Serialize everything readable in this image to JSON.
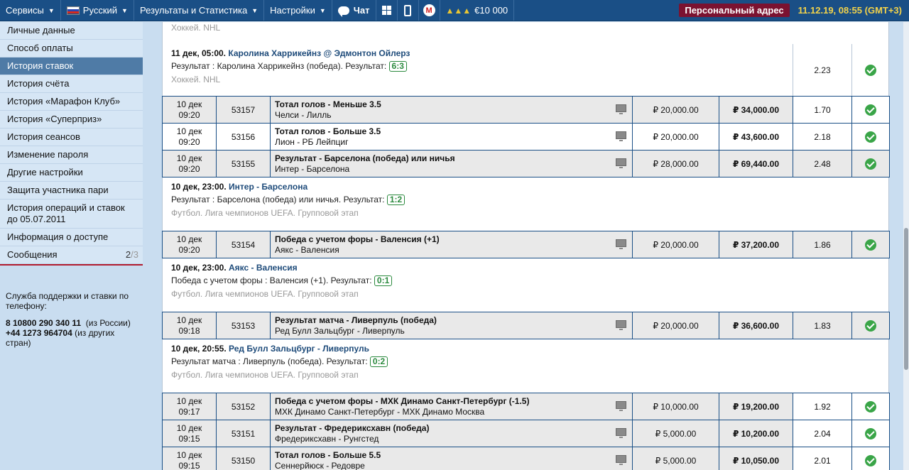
{
  "topbar": {
    "services": "Сервисы",
    "language": "Русский",
    "results": "Результаты и Статистика",
    "settings": "Настройки",
    "chat": "Чат",
    "balance": "€10 000",
    "personal": "Персональный адрес",
    "datetime": "11.12.19, 08:55 (GMT+3)"
  },
  "sidebar": {
    "items": [
      "Личные данные",
      "Способ оплаты",
      "История ставок",
      "История счёта",
      "История «Марафон Клуб»",
      "История «Суперприз»",
      "История сеансов",
      "Изменение пароля",
      "Другие настройки",
      "Защита участника пари",
      "История операций и ставок до 05.07.2011",
      "Информация о доступе",
      "Сообщения"
    ],
    "messages_read": "2",
    "messages_total": "/3",
    "support_title": "Служба поддержки и ставки по телефону:",
    "phone1": "8 10800 290 340 11",
    "phone1_note": "(из России)",
    "phone2": "+44 1273 964704",
    "phone2_note": "(из других стран)"
  },
  "top_league": "Хоккей. NHL",
  "event0": {
    "datetime": "11 дек, 05:00.",
    "teams": "Каролина Харрикейнз @ Эдмонтон Ойлерз",
    "result_text": "Результат : Каролина Харрикейнз (победа). Результат:",
    "score": "6:3",
    "league": "Хоккей. NHL",
    "odds": "2.23"
  },
  "group1": [
    {
      "date": "10 дек",
      "time": "09:20",
      "num": "53157",
      "market": "Тотал голов - Меньше 3.5",
      "match": "Челси - Лилль",
      "stake": "₽ 20,000.00",
      "win": "₽ 34,000.00",
      "odds": "1.70"
    },
    {
      "date": "10 дек",
      "time": "09:20",
      "num": "53156",
      "market": "Тотал голов - Больше 3.5",
      "match": "Лион - РБ Лейпциг",
      "stake": "₽ 20,000.00",
      "win": "₽ 43,600.00",
      "odds": "2.18"
    },
    {
      "date": "10 дек",
      "time": "09:20",
      "num": "53155",
      "market": "Результат - Барселона (победа) или ничья",
      "match": "Интер - Барселона",
      "stake": "₽ 28,000.00",
      "win": "₽ 69,440.00",
      "odds": "2.48"
    }
  ],
  "event1": {
    "datetime": "10 дек, 23:00.",
    "teams": "Интер - Барселона",
    "result_text": "Результат : Барселона (победа) или ничья. Результат:",
    "score": "1:2",
    "league": "Футбол. Лига чемпионов UEFA. Групповой этап"
  },
  "bet2": {
    "date": "10 дек",
    "time": "09:20",
    "num": "53154",
    "market": "Победа с учетом форы - Валенсия (+1)",
    "match": "Аякс - Валенсия",
    "stake": "₽ 20,000.00",
    "win": "₽ 37,200.00",
    "odds": "1.86"
  },
  "event2": {
    "datetime": "10 дек, 23:00.",
    "teams": "Аякс - Валенсия",
    "result_text": "Победа с учетом форы : Валенсия (+1). Результат:",
    "score": "0:1",
    "league": "Футбол. Лига чемпионов UEFA. Групповой этап"
  },
  "bet3": {
    "date": "10 дек",
    "time": "09:18",
    "num": "53153",
    "market": "Результат матча - Ливерпуль (победа)",
    "match": "Ред Булл Зальцбург - Ливерпуль",
    "stake": "₽ 20,000.00",
    "win": "₽ 36,600.00",
    "odds": "1.83"
  },
  "event3": {
    "datetime": "10 дек, 20:55.",
    "teams": "Ред Булл Зальцбург - Ливерпуль",
    "result_text": "Результат матча : Ливерпуль (победа). Результат:",
    "score": "0:2",
    "league": "Футбол. Лига чемпионов UEFA. Групповой этап"
  },
  "group4": [
    {
      "date": "10 дек",
      "time": "09:17",
      "num": "53152",
      "market": "Победа с учетом форы - МХК Динамо Санкт-Петербург (-1.5)",
      "match": "МХК Динамо Санкт-Петербург - МХК Динамо Москва",
      "stake": "₽ 10,000.00",
      "win": "₽ 19,200.00",
      "odds": "1.92"
    },
    {
      "date": "10 дек",
      "time": "09:15",
      "num": "53151",
      "market": "Результат - Фредериксхавн (победа)",
      "match": "Фредериксхавн - Рунгстед",
      "stake": "₽ 5,000.00",
      "win": "₽ 10,200.00",
      "odds": "2.04"
    },
    {
      "date": "10 дек",
      "time": "09:15",
      "num": "53150",
      "market": "Тотал голов - Больше 5.5",
      "match": "Сеннерйюск - Редовре",
      "stake": "₽ 5,000.00",
      "win": "₽ 10,050.00",
      "odds": "2.01"
    }
  ]
}
